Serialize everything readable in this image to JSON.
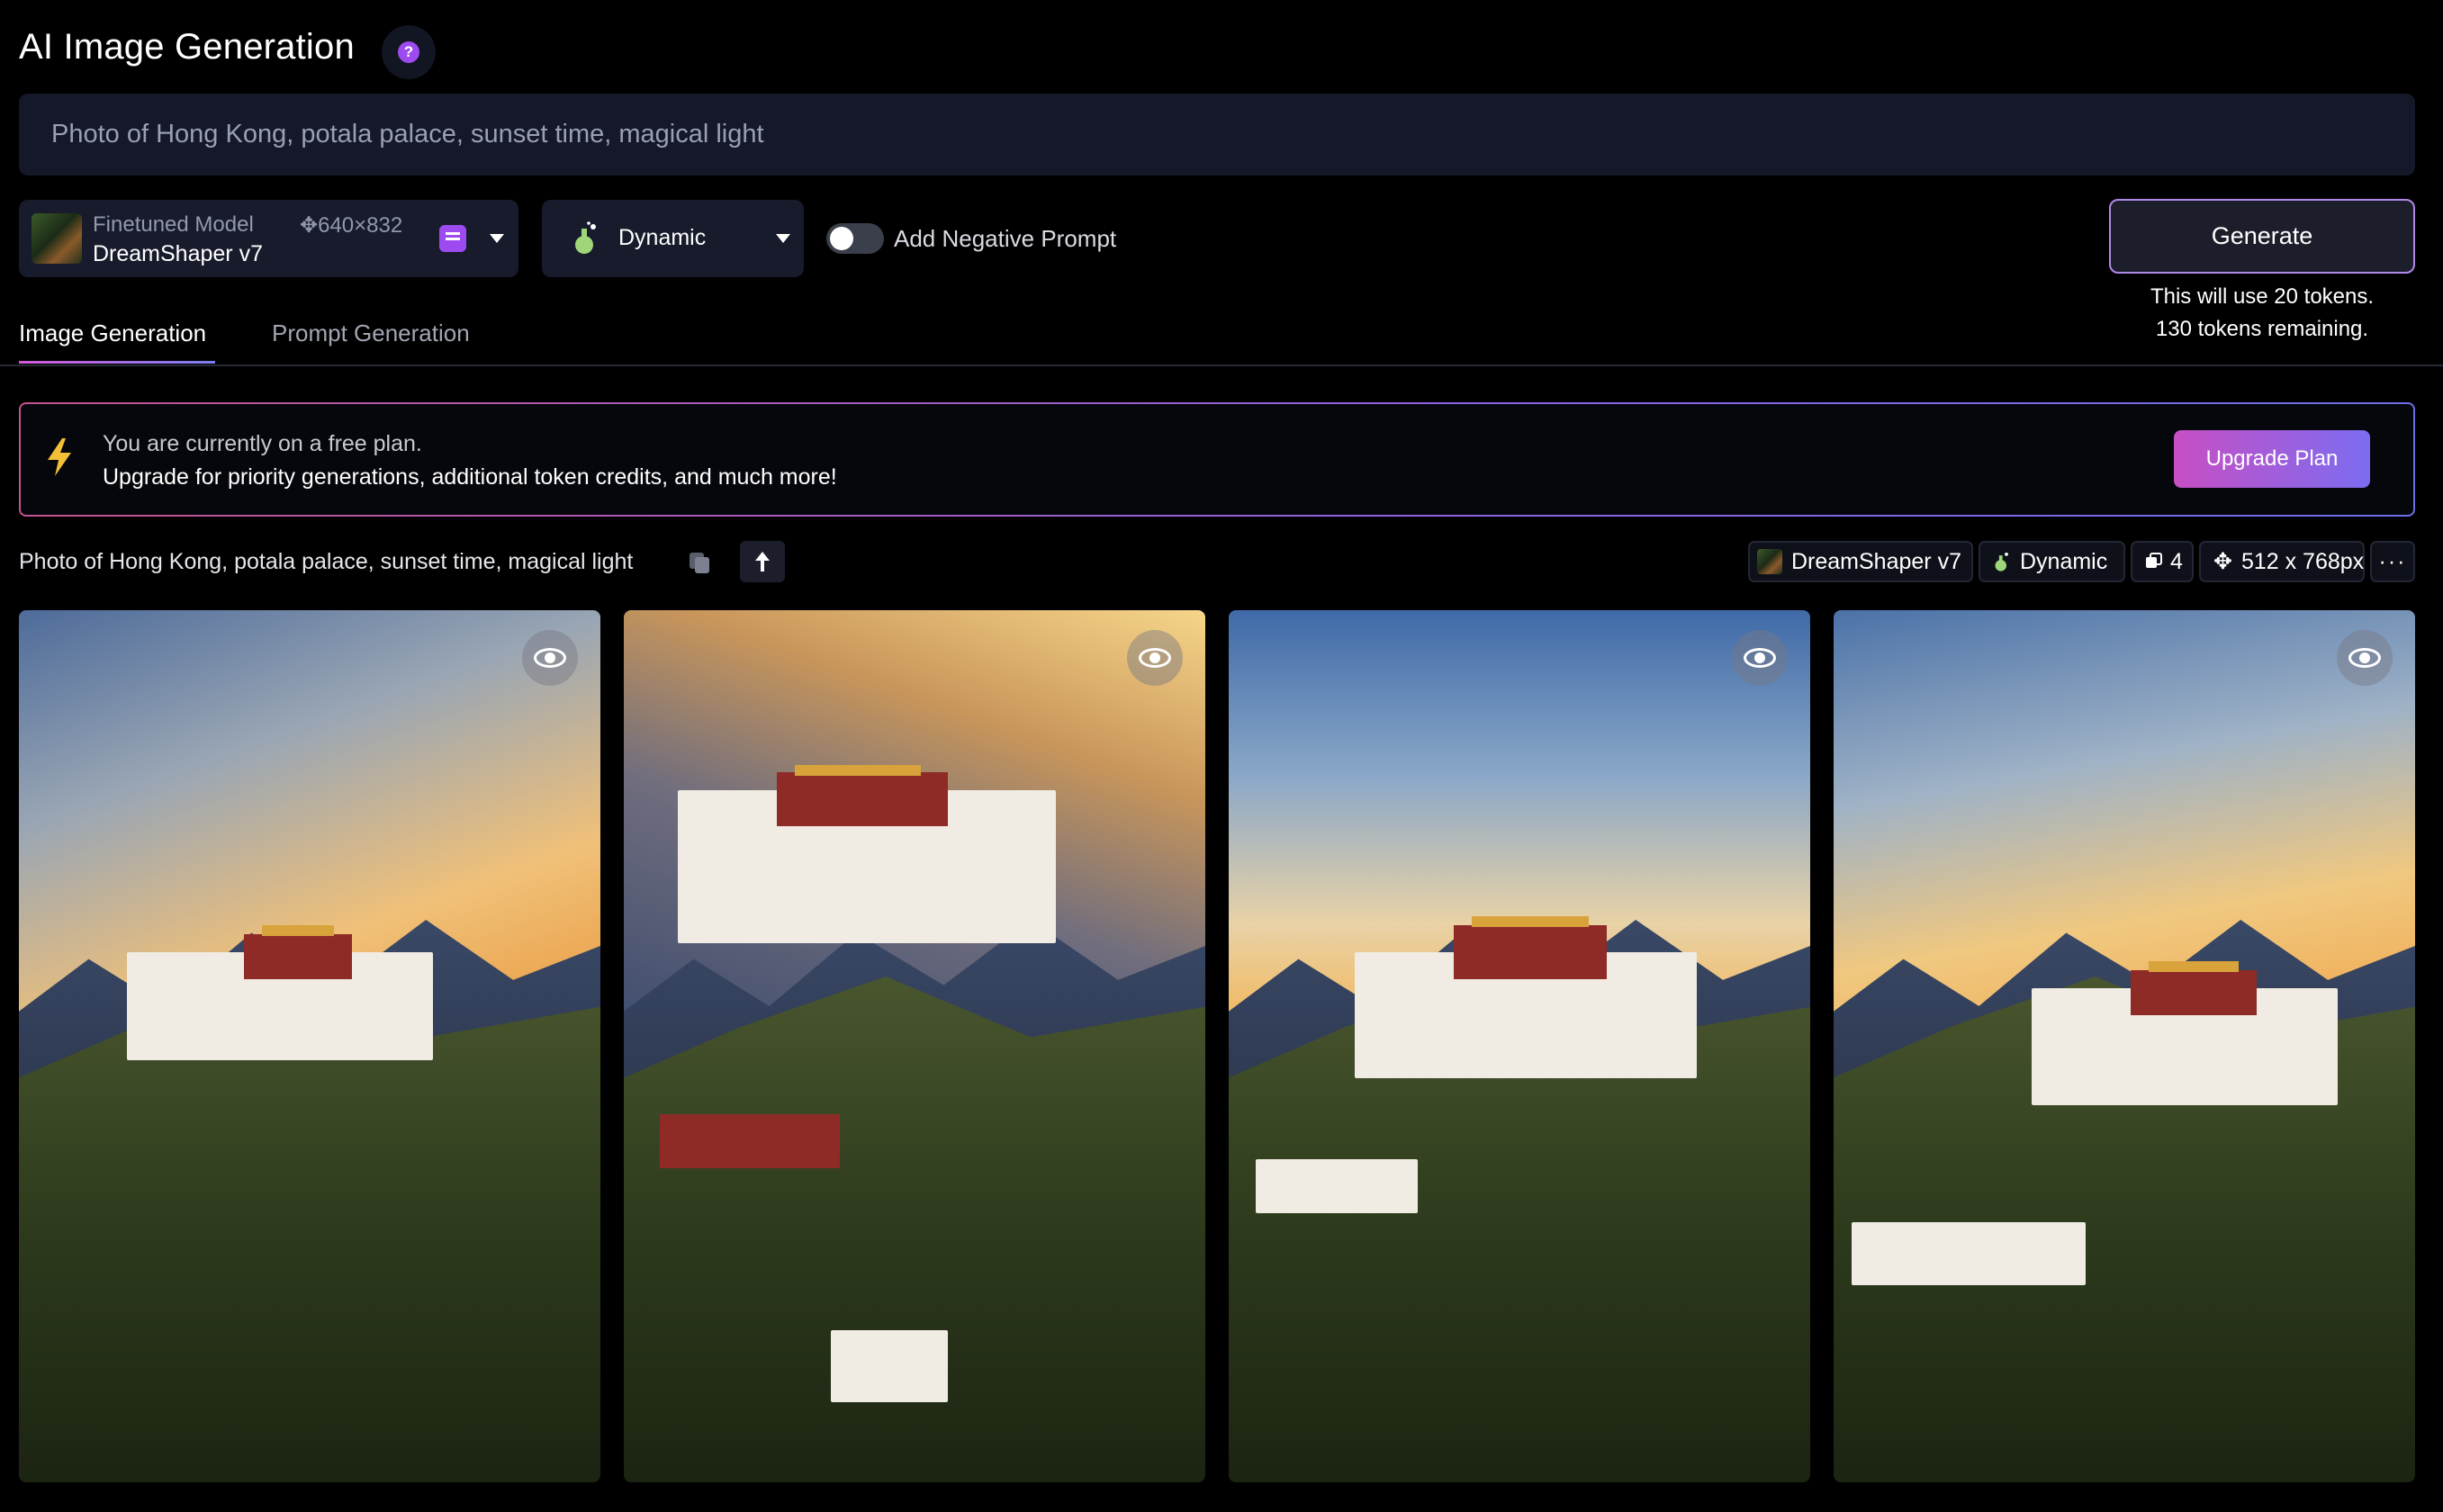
{
  "header": {
    "title": "AI Image Generation",
    "help_icon": "question-mark-icon"
  },
  "prompt": {
    "value": "Photo of Hong Kong, potala palace, sunset time, magical light"
  },
  "model": {
    "caption": "Finetuned Model",
    "dimensions": "✥640×832",
    "name": "DreamShaper v7"
  },
  "style": {
    "label": "Dynamic"
  },
  "negative_prompt": {
    "label": "Add Negative Prompt",
    "enabled": false
  },
  "generate": {
    "label": "Generate",
    "tokens_use": "This will use 20 tokens.",
    "tokens_remaining": "130 tokens remaining."
  },
  "tabs": [
    {
      "label": "Image Generation",
      "active": true
    },
    {
      "label": "Prompt Generation",
      "active": false
    }
  ],
  "banner": {
    "line1": "You are currently on a free plan.",
    "line2": "Upgrade for priority generations, additional token credits, and much more!",
    "button": "Upgrade Plan"
  },
  "generation": {
    "prompt": "Photo of Hong Kong, potala palace, sunset time, magical light",
    "model_chip": "DreamShaper v7",
    "style_chip": "Dynamic",
    "count_chip": "4",
    "size_chip": "512 x 768px",
    "more": "···"
  },
  "colors": {
    "background": "#000000",
    "input_bg": "#141828",
    "accent_purple": "#9d4bf0",
    "banner_gradient_start": "#c4538f",
    "banner_gradient_end": "#6e6ee8"
  }
}
